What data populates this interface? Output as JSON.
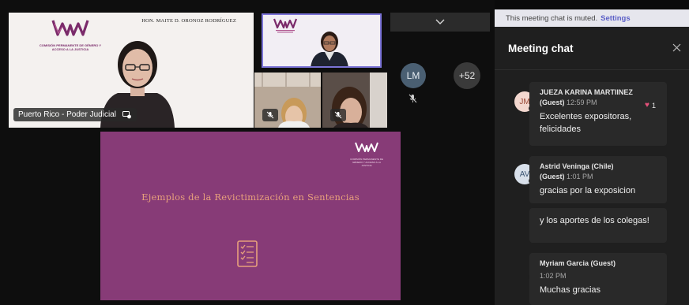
{
  "stage": {
    "main_tile": {
      "header_name": "HON. MAITE D. ORONOZ RODRÍGUEZ",
      "caption": "Puerto Rico - Poder Judicial",
      "logo_text": "COMISIÓN PERMANENTE DE GÉNERO Y ACCESO A LA JUSTICIA"
    },
    "collapse_icon": "chevron-down-icon",
    "lm_initials": "LM",
    "more_count": "+52",
    "slide": {
      "title": "Ejemplos de la Revictimización en Sentencias",
      "logo_text": "COMISIÓN PERMANENTE DE GÉNERO Y ACCESO A LA JUSTICIA",
      "icon": "checklist-icon"
    }
  },
  "chat": {
    "muted_text": "This meeting chat is muted.",
    "settings_link": "Settings",
    "title": "Meeting chat",
    "messages": [
      {
        "initials": "JM",
        "author": "JUEZA KARINA MARTIINEZ",
        "guest": "(Guest)",
        "time": "12:59 PM",
        "reaction_count": "1",
        "text": "Excelentes expositoras, felicidades",
        "avatar_color": "#f3d7cf",
        "avatar_text_color": "#9b4a38"
      },
      {
        "initials": "AV",
        "author": "Astrid Veninga (Chile)",
        "guest": "(Guest)",
        "time": "1:01 PM",
        "text": "gracias por la exposicion",
        "text2": "y los aportes de los colegas!",
        "avatar_color": "#d8e0ea",
        "avatar_text_color": "#3a5472"
      },
      {
        "author": "Myriam Garcia (Guest)",
        "time": "1:02 PM",
        "text": "Muchas gracias"
      }
    ]
  }
}
